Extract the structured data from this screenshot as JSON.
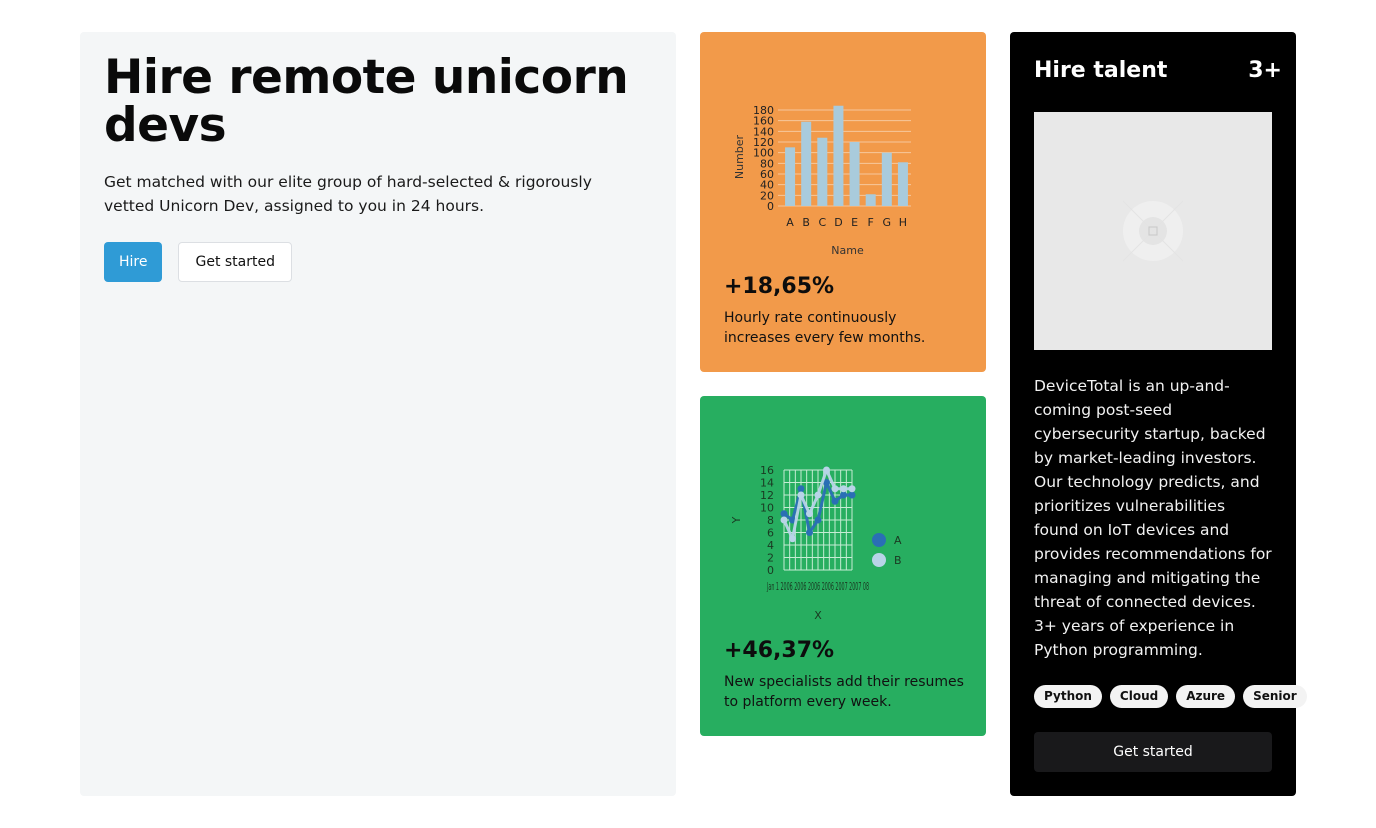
{
  "hero": {
    "title": "Hire remote unicorn devs",
    "description": "Get matched with our elite group of hard-selected & rigorously vetted Unicorn Dev, assigned to you in 24 hours.",
    "primary_button": "Hire",
    "secondary_button": "Get started"
  },
  "cards": [
    {
      "stat": "+18,65%",
      "description": "Hourly rate continuously increases every few months.",
      "background": "#f29a4a"
    },
    {
      "stat": "+46,37%",
      "description": "New specialists add their resumes to platform every week.",
      "background": "#27ae60"
    }
  ],
  "talent": {
    "title": "Hire talent",
    "count": "3+",
    "image_icon": "image-placeholder-icon",
    "description": "DeviceTotal is an up-and-coming post-seed cybersecurity startup, backed by market-leading investors. Our technology predicts, and prioritizes vulnerabilities found on IoT devices and provides recommendations for managing and mitigating the threat of connected devices. 3+ years of experience in Python programming.",
    "tags": [
      "Python",
      "Cloud",
      "Azure",
      "Senior"
    ],
    "button": "Get started"
  },
  "colors": {
    "primary": "#2f9bd6",
    "orange": "#f29a4a",
    "green": "#27ae60",
    "bar": "#a9cbdc",
    "series_a": "#2a6fb5",
    "series_b": "#b8d4e8"
  },
  "chart_data": [
    {
      "type": "bar",
      "categories": [
        "A",
        "B",
        "C",
        "D",
        "E",
        "F",
        "G",
        "H"
      ],
      "values": [
        110,
        158,
        128,
        188,
        120,
        22,
        100,
        82
      ],
      "xlabel": "Name",
      "ylabel": "Number",
      "ylim": [
        0,
        180
      ],
      "yticks": [
        0,
        20,
        40,
        60,
        80,
        100,
        120,
        140,
        160,
        180
      ],
      "grid": true,
      "legend": "none"
    },
    {
      "type": "line",
      "x": [
        "Jan",
        "1",
        "2",
        "3",
        "4",
        "5",
        "6",
        "7",
        "8"
      ],
      "x_tick_text": "Jan 1 2006 2006 2006 2006 2007 2007 08",
      "series": [
        {
          "name": "A",
          "values": [
            9,
            8,
            13,
            6,
            8,
            14,
            11,
            12,
            12
          ]
        },
        {
          "name": "B",
          "values": [
            8,
            5,
            12,
            9,
            12,
            16,
            13,
            13,
            13
          ]
        }
      ],
      "xlabel": "X",
      "ylabel": "Y",
      "ylim": [
        0,
        16
      ],
      "yticks": [
        0,
        2,
        4,
        6,
        8,
        10,
        12,
        14,
        16
      ],
      "grid": true,
      "legend": "right"
    }
  ]
}
